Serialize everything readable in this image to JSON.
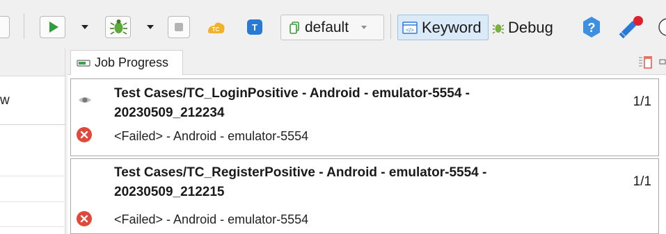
{
  "toolbar": {
    "profile_label": "default",
    "keyword_label": "Keyword",
    "debug_label": "Debug",
    "icons": [
      "run-icon",
      "debug-bug-icon",
      "stop-icon",
      "testcloud-icon",
      "testops-icon",
      "profile-copy-icon",
      "help-icon",
      "notification-icon"
    ],
    "accent_color": "#2a7ad5"
  },
  "left_pane": {
    "header_text": "w"
  },
  "job_progress": {
    "tab_label": "Job Progress",
    "jobs": [
      {
        "title_line1": "Test Cases/TC_LoginPositive - Android - emulator-5554 -",
        "title_line2": "20230509_212234",
        "progress": "1/1",
        "status": "<Failed> - Android - emulator-5554"
      },
      {
        "title_line1": "Test Cases/TC_RegisterPositive - Android - emulator-5554 -",
        "title_line2": "20230509_212215",
        "progress": "1/1",
        "status": "<Failed> - Android - emulator-5554"
      }
    ],
    "failed_color": "#e1483a"
  }
}
